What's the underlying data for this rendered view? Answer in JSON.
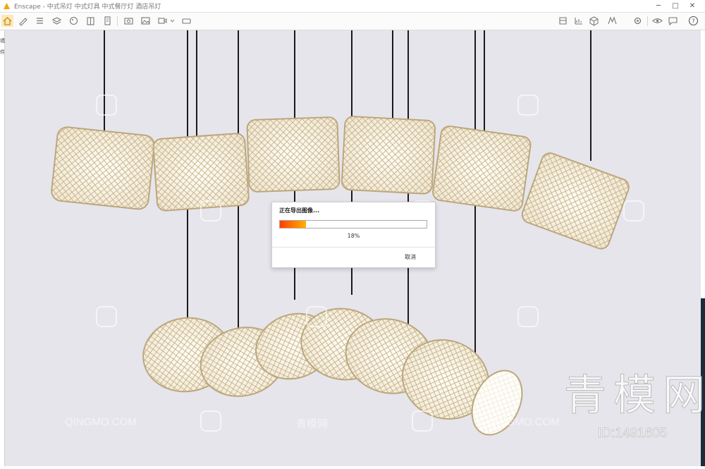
{
  "window": {
    "title": "Enscape - 中式吊灯 中式灯具 中式餐厅灯 酒店吊灯",
    "minimize_label": "─",
    "maximize_label": "□",
    "close_label": "✕"
  },
  "toolbar": {
    "icons": [
      "home-icon",
      "pencil-icon",
      "list-icon",
      "layers-icon",
      "palette-icon",
      "book-icon",
      "building-icon",
      "camera-icon",
      "picture-icon",
      "image-export-icon",
      "video-icon",
      "panorama-icon",
      "chevron-down-icon",
      "settings-icon",
      "chart-icon",
      "cube-icon",
      "asset-icon",
      "collab-icon",
      "eye-icon",
      "help-icon"
    ]
  },
  "gutter": {
    "chars": [
      "墙",
      "件"
    ]
  },
  "dialog": {
    "title": "正在导出图像...",
    "progress_percent": 18,
    "progress_label": "18%",
    "cancel_label": "取消"
  },
  "watermark": {
    "brand": "青模网",
    "id": "ID:1491605",
    "small": [
      "QINGMO.COM",
      "青模网"
    ]
  },
  "colors": {
    "background": "#e6e5ec",
    "progress_start": "#ff3d00",
    "progress_end": "#ffb300",
    "lamp_frame": "#c8b48a",
    "lamp_glow": "#fbf6ea",
    "cord": "#1a1a1a"
  }
}
